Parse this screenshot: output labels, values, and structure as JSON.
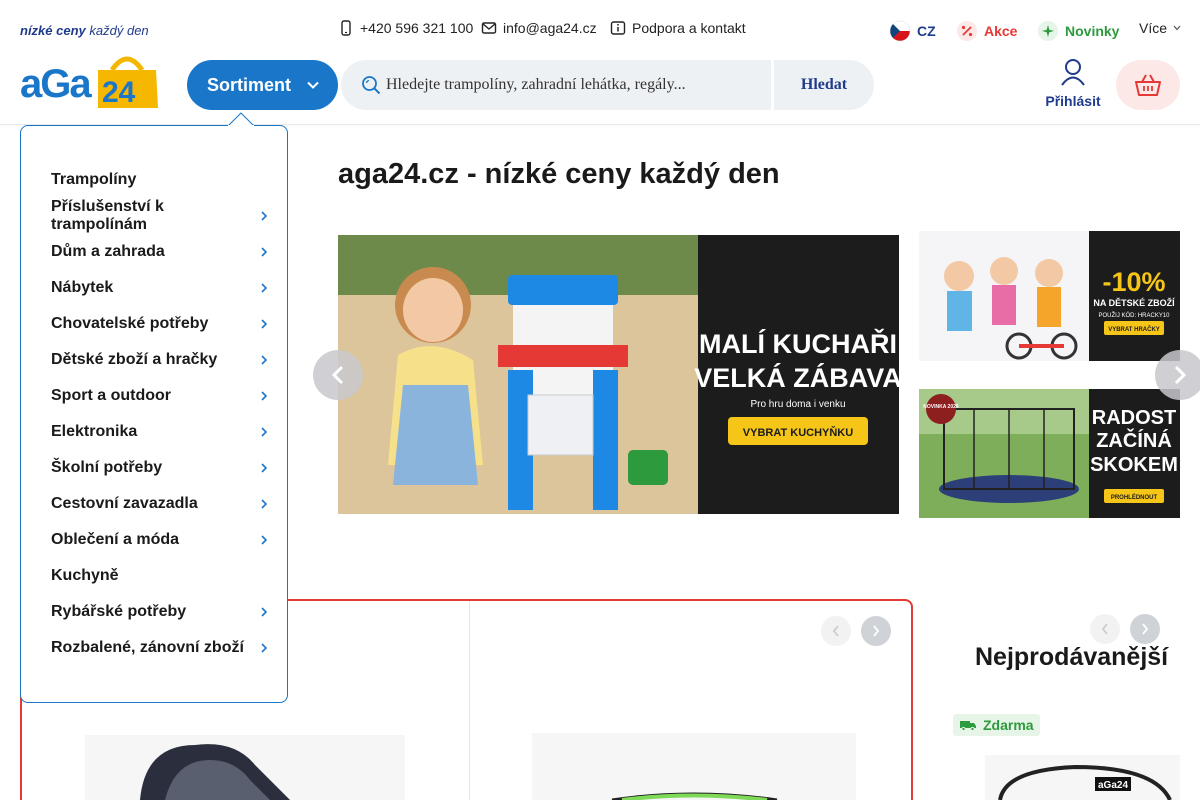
{
  "topbar": {
    "tagline_bold": "nízké ceny",
    "tagline_rest": "každý den",
    "phone": "+420 596 321 100",
    "email": "info@aga24.cz",
    "support": "Podpora a kontakt",
    "lang": "CZ",
    "akce": "Akce",
    "novinky": "Novinky",
    "vice": "Více"
  },
  "header": {
    "logo_text": "aGa24",
    "sortiment": "Sortiment",
    "search_placeholder": "Hledejte trampolíny, zahradní lehátka, regály...",
    "search_button": "Hledat",
    "login": "Přihlásit"
  },
  "menu": {
    "items": [
      {
        "label": "Trampolíny",
        "has_sub": false
      },
      {
        "label": "Příslušenství k trampolínám",
        "has_sub": true
      },
      {
        "label": "Dům a zahrada",
        "has_sub": true
      },
      {
        "label": "Nábytek",
        "has_sub": true
      },
      {
        "label": "Chovatelské potřeby",
        "has_sub": true
      },
      {
        "label": "Dětské zboží a hračky",
        "has_sub": true
      },
      {
        "label": "Sport a outdoor",
        "has_sub": true
      },
      {
        "label": "Elektronika",
        "has_sub": true
      },
      {
        "label": "Školní potřeby",
        "has_sub": true
      },
      {
        "label": "Cestovní zavazadla",
        "has_sub": true
      },
      {
        "label": "Oblečení a móda",
        "has_sub": true
      },
      {
        "label": "Kuchyně",
        "has_sub": false
      },
      {
        "label": "Rybářské potřeby",
        "has_sub": true
      },
      {
        "label": "Rozbalené, zánovní zboží",
        "has_sub": true
      }
    ]
  },
  "main": {
    "title": "aga24.cz - nízké ceny každý den",
    "banner_main": {
      "line1": "MALÍ KUCHAŘI",
      "line2": "VELKÁ ZÁBAVA",
      "sub": "Pro hru doma i venku",
      "cta": "VYBRAT KUCHYŇKU"
    },
    "banner_side1": {
      "big": "-10%",
      "sub": "NA DĚTSKÉ ZBOŽÍ",
      "code": "POUŽIJ KÓD: HRACKY10",
      "cta": "VYBRAT HRAČKY"
    },
    "banner_side2": {
      "line1": "RADOST",
      "line2": "ZAČÍNÁ",
      "line3": "SKOKEM",
      "tag": "NOVINKA 2026",
      "cta": "PROHLÉDNOUT"
    },
    "bestsellers_title": "Nejprodávanější",
    "free_badge": "Zdarma"
  },
  "colors": {
    "brand_blue": "#1976c9",
    "navy": "#1f3b8c",
    "accent_red": "#e53935",
    "green": "#2e9a3e",
    "banner_yellow": "#f5c518"
  }
}
